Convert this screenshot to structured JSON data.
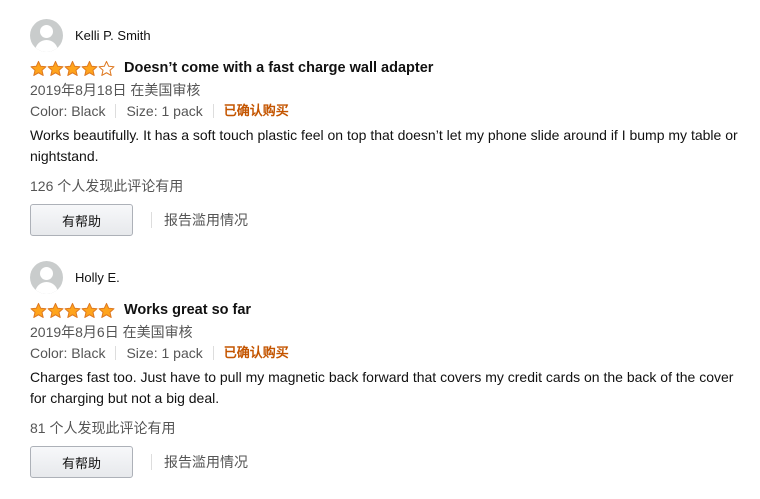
{
  "colors": {
    "star": "#ffa41c",
    "star_outline": "#de7921",
    "verified": "#c45500",
    "avatar_bg": "#c9cccc"
  },
  "reviews": [
    {
      "reviewer": "Kelli P. Smith",
      "rating": 4,
      "max_rating": 5,
      "title": "Doesn’t come with a fast charge wall adapter",
      "date": "2019年8月18日 在美国审核",
      "color": "Color: Black",
      "size": "Size: 1 pack",
      "verified": "已确认购买",
      "body": "Works beautifully. It has a soft touch plastic feel on top that doesn’t let my phone slide around if I bump my table or nightstand.",
      "helpful_count": "126 个人发现此评论有用",
      "helpful_label": "有帮助",
      "report_label": "报告滥用情况"
    },
    {
      "reviewer": "Holly E.",
      "rating": 5,
      "max_rating": 5,
      "title": "Works great so far",
      "date": "2019年8月6日 在美国审核",
      "color": "Color: Black",
      "size": "Size: 1 pack",
      "verified": "已确认购买",
      "body": "Charges fast too. Just have to pull my magnetic back forward that covers my credit cards on the back of the cover for charging but not a big deal.",
      "helpful_count": "81 个人发现此评论有用",
      "helpful_label": "有帮助",
      "report_label": "报告滥用情况"
    }
  ]
}
